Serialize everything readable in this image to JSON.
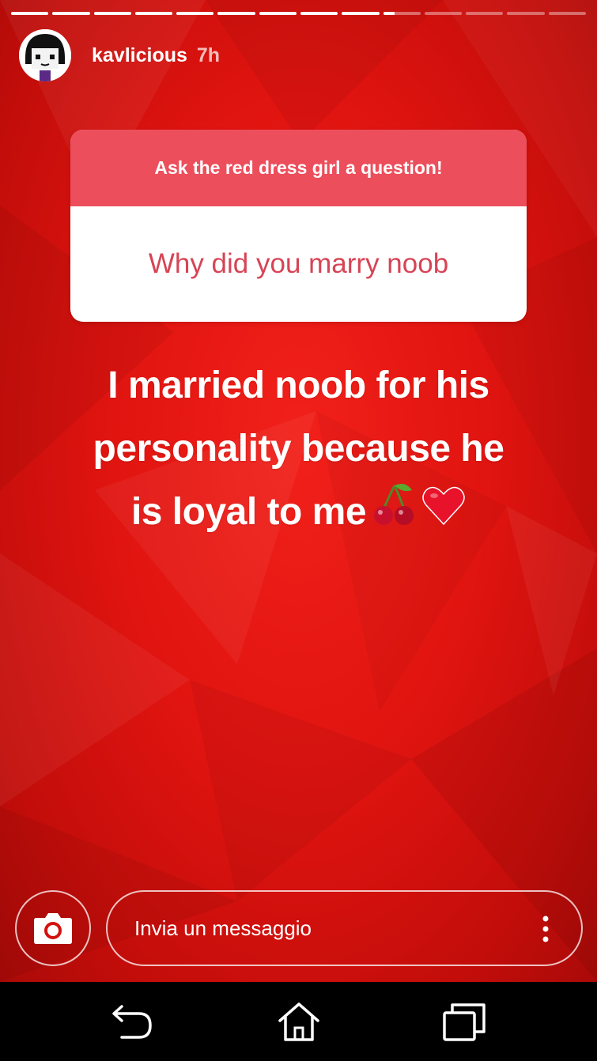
{
  "story": {
    "progress": {
      "segments": 14,
      "completed": 9,
      "current_fraction": 0.3
    },
    "user": {
      "username": "kavlicious",
      "time_ago": "7h",
      "avatar_icon": "roblox-avatar-icon"
    },
    "question_sticker": {
      "prompt": "Ask the red dress girl a question!",
      "answer": "Why did you marry noob"
    },
    "caption": {
      "line1": "I married noob for his",
      "line2": "personality because he",
      "line3": "is loyal to me",
      "emojis": [
        "cherries-icon",
        "red-heart-icon"
      ]
    },
    "colors": {
      "background": "#e01410",
      "sticker_header": "#ed4e5c",
      "sticker_answer_text": "#d74455"
    }
  },
  "reply_bar": {
    "camera_icon": "camera-icon",
    "placeholder": "Invia un messaggio",
    "more_icon": "more-vertical-icon"
  },
  "system_nav": {
    "back_icon": "back-icon",
    "home_icon": "home-icon",
    "recents_icon": "recent-apps-icon"
  }
}
